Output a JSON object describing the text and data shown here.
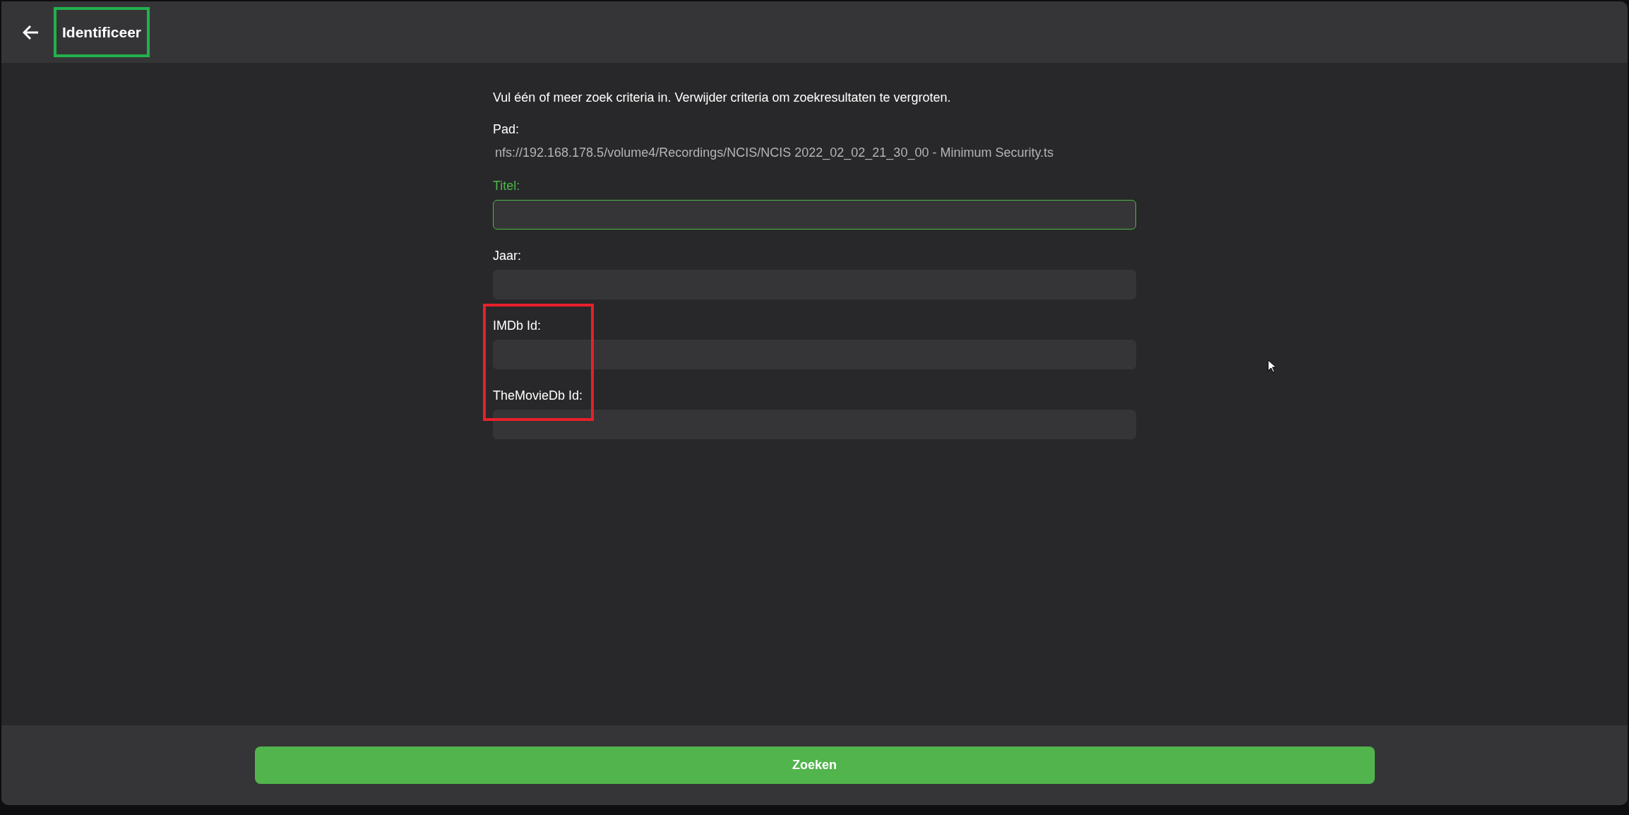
{
  "header": {
    "title": "Identificeer",
    "title_frame": {
      "color": "#22b14c"
    }
  },
  "intro": "Vul één of meer zoek criteria in. Verwijder criteria om zoekresultaten te vergroten.",
  "path": {
    "label": "Pad:",
    "value": "nfs://192.168.178.5/volume4/Recordings/NCIS/NCIS 2022_02_02_21_30_00 - Minimum Security.ts"
  },
  "fields": [
    {
      "label": "Titel:",
      "focused": true,
      "framed": false
    },
    {
      "label": "Jaar:",
      "focused": false,
      "framed": false
    },
    {
      "label": "IMDb Id:",
      "focused": false,
      "framed": true
    },
    {
      "label": "TheMovieDb Id:",
      "focused": false,
      "framed": true
    }
  ],
  "field_frame": {
    "color": "#e8202a"
  },
  "search_button": "Zoeken"
}
